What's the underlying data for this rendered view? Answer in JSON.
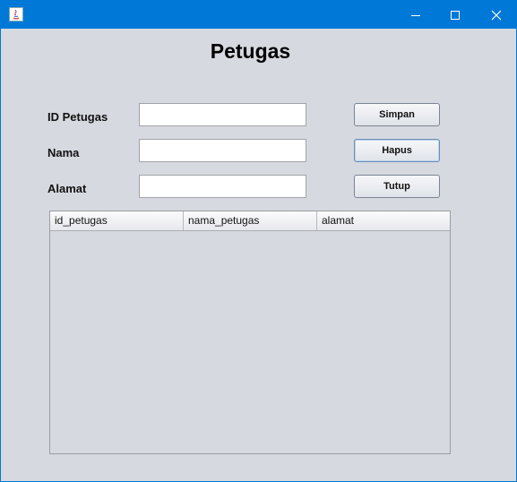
{
  "window": {
    "title": "",
    "controls": {
      "minimize": "minimize",
      "maximize": "maximize",
      "close": "close"
    }
  },
  "form": {
    "title": "Petugas",
    "fields": [
      {
        "label": "ID Petugas",
        "value": ""
      },
      {
        "label": "Nama",
        "value": ""
      },
      {
        "label": "Alamat",
        "value": ""
      }
    ],
    "buttons": {
      "simpan": "Simpan",
      "hapus": "Hapus",
      "tutup": "Tutup"
    }
  },
  "table": {
    "columns": [
      "id_petugas",
      "nama_petugas",
      "alamat"
    ],
    "rows": []
  },
  "colors": {
    "titlebar": "#0078d7",
    "background": "#d6d9df"
  }
}
